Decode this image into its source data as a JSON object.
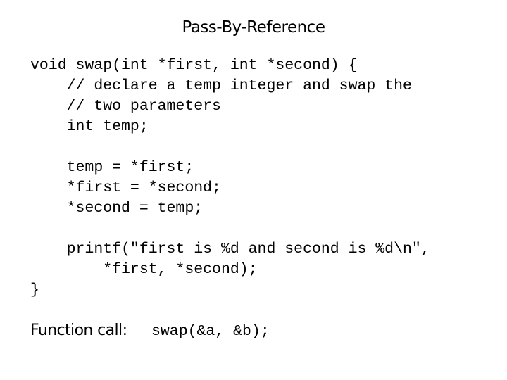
{
  "slide": {
    "title": "Pass-By-Reference",
    "code_lines": [
      "void swap(int *first, int *second) {",
      "    // declare a temp integer and swap the",
      "    // two parameters",
      "    int temp;",
      "",
      "    temp = *first;",
      "    *first = *second;",
      "    *second = temp;",
      "",
      "    printf(\"first is %d and second is %d\\n\",",
      "        *first, *second);",
      "}"
    ],
    "function_call": {
      "label": "Function call:",
      "code": "swap(&a, &b);"
    }
  }
}
